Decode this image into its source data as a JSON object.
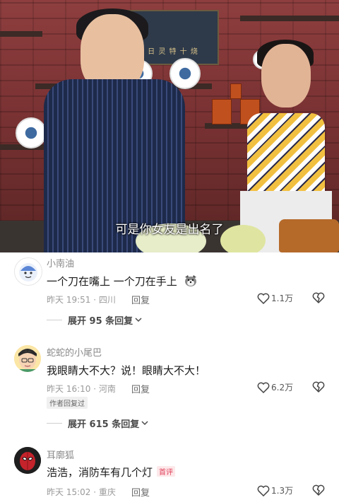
{
  "video": {
    "subtitle": "可是你女友是出名了",
    "sign_text": "日 灵 特 十 烧"
  },
  "comments": [
    {
      "username": "小南油",
      "text": "一个刀在嘴上 一个刀在手上",
      "emoji": "dog-face",
      "time_location": "昨天 19:51 · 四川",
      "reply_label": "回复",
      "likes": "1.1万",
      "expand_label": "展开 95 条回复"
    },
    {
      "username": "蛇蛇的小尾巴",
      "text": "我眼睛大不大？说！眼睛大不大！",
      "time_location": "昨天 16:10 · 河南",
      "reply_label": "回复",
      "likes": "6.2万",
      "author_replied": "作者回复过",
      "expand_label": "展开 615 条回复"
    },
    {
      "username": "耳廓狐",
      "text": "浩浩，消防车有几个灯",
      "badge": "首评",
      "time_location": "昨天 15:02 · 重庆",
      "reply_label": "回复",
      "likes": "1.3万"
    }
  ],
  "colors": {
    "username": "#8a8a8a",
    "meta": "#9a9a9a",
    "first_badge": "#e0405a"
  }
}
